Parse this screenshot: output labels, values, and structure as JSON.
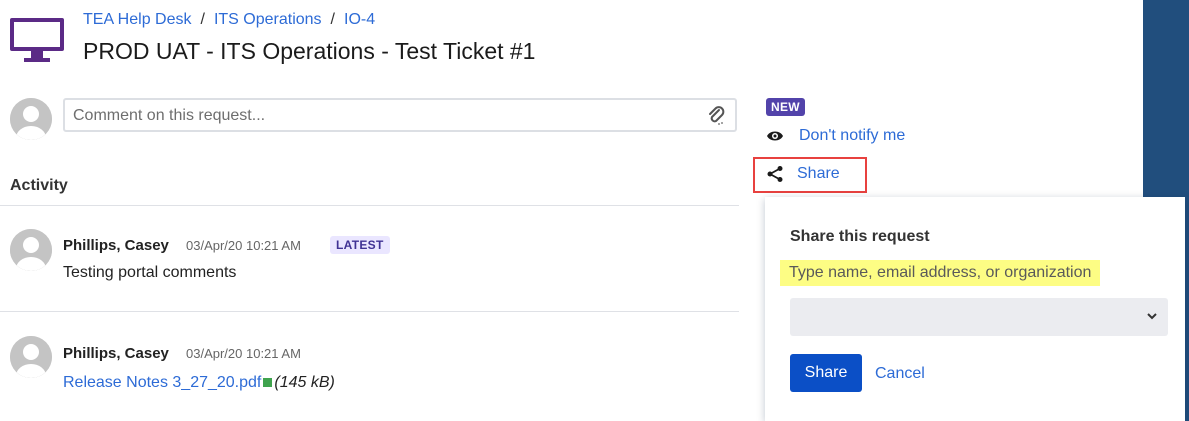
{
  "breadcrumb": {
    "items": [
      "TEA Help Desk",
      "ITS Operations",
      "IO-4"
    ],
    "separator": "/"
  },
  "ticket": {
    "title": "PROD UAT - ITS Operations - Test Ticket #1"
  },
  "comment": {
    "placeholder": "Comment on this request..."
  },
  "activity": {
    "heading": "Activity",
    "entries": [
      {
        "author": "Phillips, Casey",
        "timestamp": "03/Apr/20 10:21 AM",
        "badge": "LATEST",
        "text": "Testing portal comments"
      },
      {
        "author": "Phillips, Casey",
        "timestamp": "03/Apr/20 10:21 AM",
        "attachment": {
          "name": "Release Notes 3_27_20.pdf",
          "size": "(145 kB)"
        }
      }
    ]
  },
  "sidebar": {
    "new_badge": "NEW",
    "notify_label": "Don't notify me",
    "share_label": "Share"
  },
  "share_popup": {
    "title": "Share this request",
    "hint": "Type name, email address, or organization",
    "selected_value": "",
    "share_button": "Share",
    "cancel_label": "Cancel"
  },
  "colors": {
    "link": "#2d6bd6",
    "primary_button": "#0b4fc6",
    "new_badge": "#5243aa",
    "latest_badge_bg": "#eae6ff",
    "highlight_border": "#e8413f",
    "hint_highlight": "#fdfd84",
    "side_bar": "#214e7d",
    "portal_icon": "#5b2a86"
  },
  "icons": {
    "portal": "monitor-icon",
    "attach": "paperclip-icon",
    "watch": "eye-icon",
    "share": "share-icon",
    "select": "chevron-down-icon",
    "file": "file-icon"
  }
}
